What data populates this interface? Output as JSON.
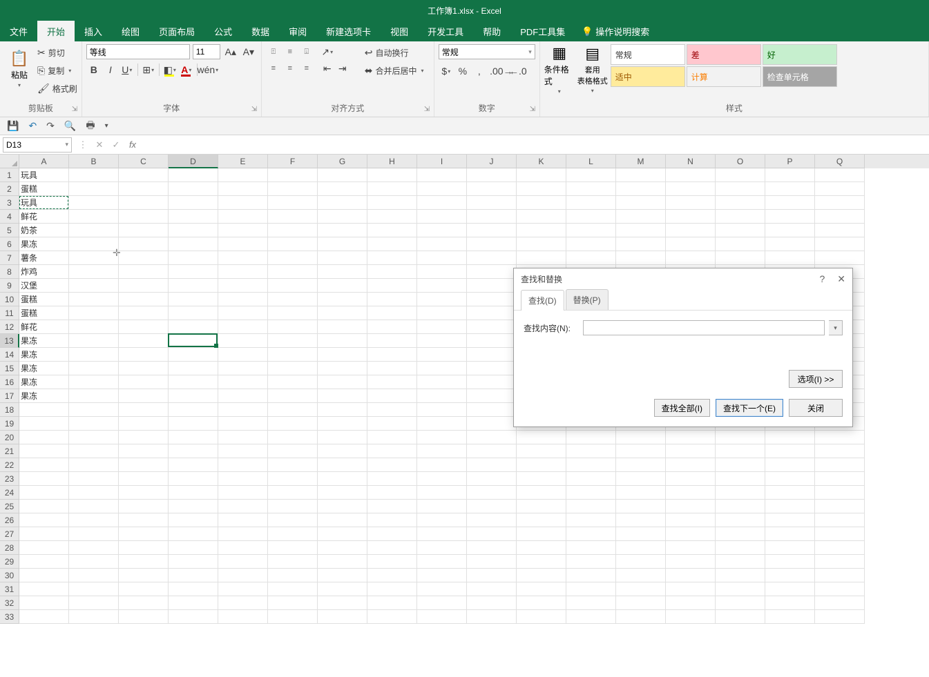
{
  "title": "工作簿1.xlsx - Excel",
  "tabs": [
    "文件",
    "开始",
    "插入",
    "绘图",
    "页面布局",
    "公式",
    "数据",
    "审阅",
    "新建选项卡",
    "视图",
    "开发工具",
    "帮助",
    "PDF工具集"
  ],
  "active_tab_index": 1,
  "tell_me": "操作说明搜索",
  "ribbon": {
    "clipboard": {
      "paste": "粘贴",
      "cut": "剪切",
      "copy": "复制",
      "format_painter": "格式刷",
      "group": "剪贴板"
    },
    "font": {
      "name": "等线",
      "size": "11",
      "group": "字体"
    },
    "alignment": {
      "wrap": "自动换行",
      "merge": "合并后居中",
      "group": "对齐方式"
    },
    "number": {
      "format": "常规",
      "group": "数字"
    },
    "styles": {
      "cond": "条件格式",
      "table": "套用\n表格格式",
      "normal": "常规",
      "bad": "差",
      "good": "好",
      "neutral": "适中",
      "calc": "计算",
      "check": "检查单元格",
      "group": "样式"
    }
  },
  "name_box": "D13",
  "columns": [
    "A",
    "B",
    "C",
    "D",
    "E",
    "F",
    "G",
    "H",
    "I",
    "J",
    "K",
    "L",
    "M",
    "N",
    "O",
    "P",
    "Q"
  ],
  "rows": 33,
  "cell_data": {
    "A1": "玩具",
    "A2": "蛋糕",
    "A3": "玩具",
    "A4": "鲜花",
    "A5": "奶茶",
    "A6": "果冻",
    "A7": "薯条",
    "A8": "炸鸡",
    "A9": "汉堡",
    "A10": "蛋糕",
    "A11": "蛋糕",
    "A12": "鲜花",
    "A13": "果冻",
    "A14": "果冻",
    "A15": "果冻",
    "A16": "果冻",
    "A17": "果冻"
  },
  "active_cell": {
    "col": 3,
    "row": 12
  },
  "dashed_cell": {
    "col": 0,
    "row": 2
  },
  "selected_row": 13,
  "selected_col": "D",
  "dialog": {
    "title": "查找和替换",
    "tab_find": "查找(D)",
    "tab_replace": "替换(P)",
    "find_label": "查找内容(N):",
    "find_value": "",
    "options": "选项(I) >>",
    "find_all": "查找全部(I)",
    "find_next": "查找下一个(E)",
    "close": "关闭"
  }
}
